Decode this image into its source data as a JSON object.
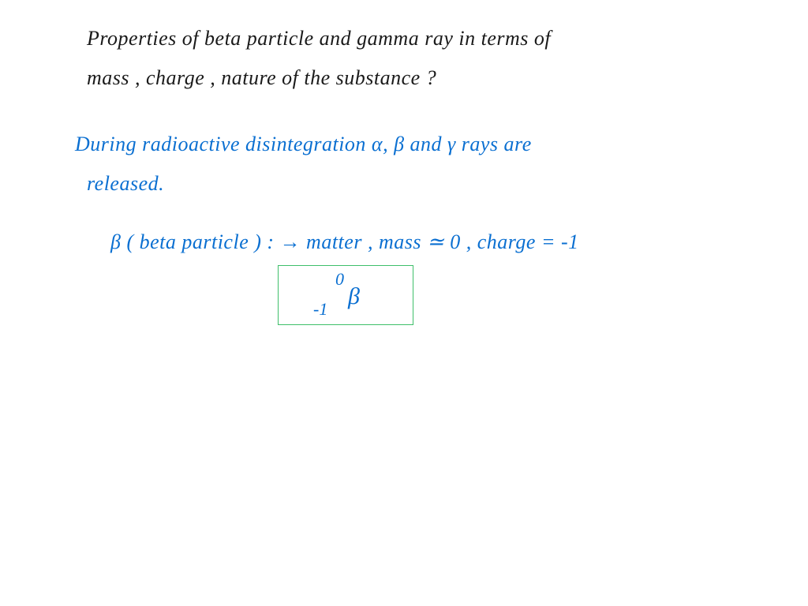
{
  "question": {
    "line1": "Properties of beta particle and gamma ray in terms of",
    "line2": "mass , charge , nature of the substance ?"
  },
  "answer": {
    "intro_line1": "During radioactive disintegration α, β and γ rays are",
    "intro_line2": "released.",
    "beta_line": "β ( beta particle ) : → matter  ,  mass ≃ 0  ,  charge = -1"
  },
  "nuclide": {
    "mass": "0",
    "charge": "-1",
    "symbol": "β"
  }
}
